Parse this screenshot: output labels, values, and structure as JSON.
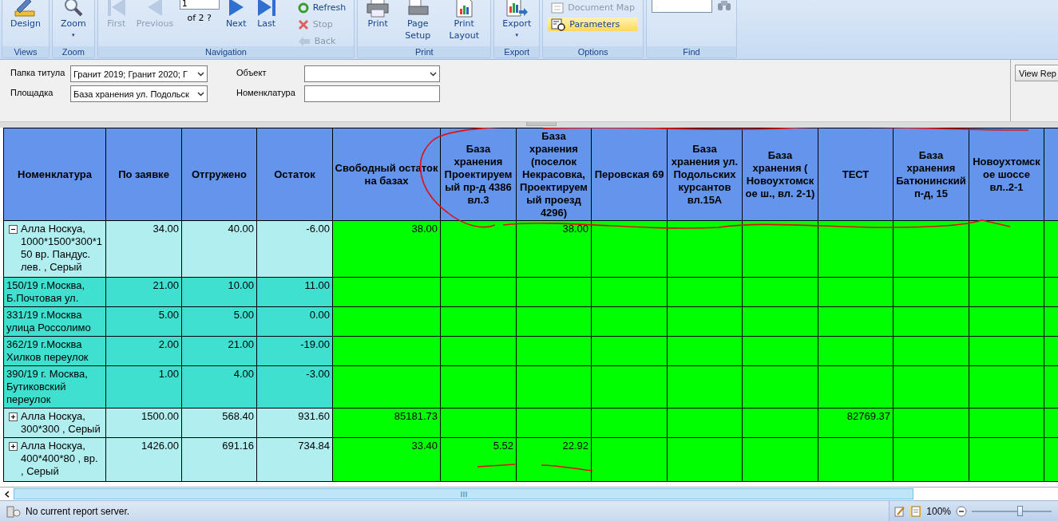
{
  "ribbon": {
    "groups": [
      {
        "label": "Views",
        "buttons": [
          {
            "label": "Design",
            "disabled": false
          }
        ]
      },
      {
        "label": "Zoom",
        "buttons": [
          {
            "label": "Zoom",
            "disabled": false,
            "caret": "▾"
          }
        ]
      },
      {
        "label": "Navigation",
        "kind": "navigation",
        "buttons": [
          {
            "label": "First",
            "disabled": true
          },
          {
            "label": "Previous",
            "disabled": true
          }
        ],
        "page": {
          "value": "1",
          "of": "of  2 ?"
        },
        "buttons_after": [
          {
            "label": "Next",
            "disabled": false
          },
          {
            "label": "Last",
            "disabled": false
          }
        ],
        "small_buttons": [
          {
            "label": "Refresh",
            "disabled": false
          },
          {
            "label": "Stop",
            "disabled": true
          },
          {
            "label": "Back",
            "disabled": true
          }
        ]
      },
      {
        "label": "Print",
        "buttons": [
          {
            "label": "Print",
            "disabled": false
          },
          {
            "label": "Page Setup",
            "disabled": false
          },
          {
            "label": "Print Layout",
            "disabled": false
          }
        ]
      },
      {
        "label": "Export",
        "buttons": [
          {
            "label": "Export",
            "disabled": false,
            "caret": "▾"
          }
        ]
      },
      {
        "label": "Options",
        "kind": "options",
        "small_buttons": [
          {
            "label": "Document Map",
            "disabled": true,
            "selected": false
          },
          {
            "label": "Parameters",
            "disabled": false,
            "selected": true
          }
        ]
      },
      {
        "label": "Find",
        "kind": "find"
      }
    ]
  },
  "parameters": {
    "fields": [
      {
        "label": "Папка титула",
        "kind": "dropdown",
        "value": "Гранит 2019; Гранит 2020; Г"
      },
      {
        "label": "Объект",
        "kind": "dropdown"
      },
      {
        "label": "Площадка",
        "kind": "dropdown",
        "value": "База хранения ул. Подольск"
      },
      {
        "label": "Номенклатура",
        "kind": "text"
      }
    ],
    "view_button": "View Rep"
  },
  "table": {
    "columns": [
      "Номенклатура",
      "По заявке",
      "Отгружено",
      "Остаток",
      "Свободный остаток на базах",
      "База хранения Проектируемый пр-д 4386 вл.3",
      "База хранения (поселок Некрасовка, Проектируемый проезд 4296)",
      "Перовская 69",
      "База хранения ул. Подольских курсантов вл.15А",
      "База хранения ( Новоухтомское ш., вл. 2-1)",
      "ТЕСТ",
      "База хранения Батюнинский п-д, 15",
      "Новоухтомское шоссе вл..2-1"
    ],
    "rows": [
      {
        "kind": "group",
        "expanded": true,
        "name": "Алла Носкуа, 1000*1500*300*150 вр. Пандус. лев. , Серый",
        "ordered": "34.00",
        "shipped": "40.00",
        "remaining": "-6.00",
        "free": "38.00",
        "base_2": "38.00"
      },
      {
        "kind": "item",
        "name": "150/19 г.Москва, Б.Почтовая ул.",
        "ordered": "21.00",
        "shipped": "10.00",
        "remaining": "11.00"
      },
      {
        "kind": "item",
        "name": "331/19 г.Москва улица Россолимо",
        "ordered": "5.00",
        "shipped": "5.00",
        "remaining": "0.00"
      },
      {
        "kind": "item",
        "name": "362/19 г.Москва Хилков переулок",
        "ordered": "2.00",
        "shipped": "21.00",
        "remaining": "-19.00"
      },
      {
        "kind": "item",
        "name": "390/19 г. Москва, Бутиковский переулок",
        "ordered": "1.00",
        "shipped": "4.00",
        "remaining": "-3.00"
      },
      {
        "kind": "group",
        "expanded": false,
        "name": "Алла Носкуа, 300*300 , Серый",
        "ordered": "1500.00",
        "shipped": "568.40",
        "remaining": "931.60",
        "free": "85181.73",
        "base_6": "82769.37"
      },
      {
        "kind": "group",
        "expanded": false,
        "name": "Алла Носкуа, 400*400*80 , вр. , Серый",
        "ordered": "1426.00",
        "shipped": "691.16",
        "remaining": "734.84",
        "free": "33.40",
        "base_1": "5.52",
        "base_2": "22.92"
      }
    ]
  },
  "status_bar": {
    "text": "No current report server.",
    "zoom": "100%",
    "level": 0.6
  }
}
